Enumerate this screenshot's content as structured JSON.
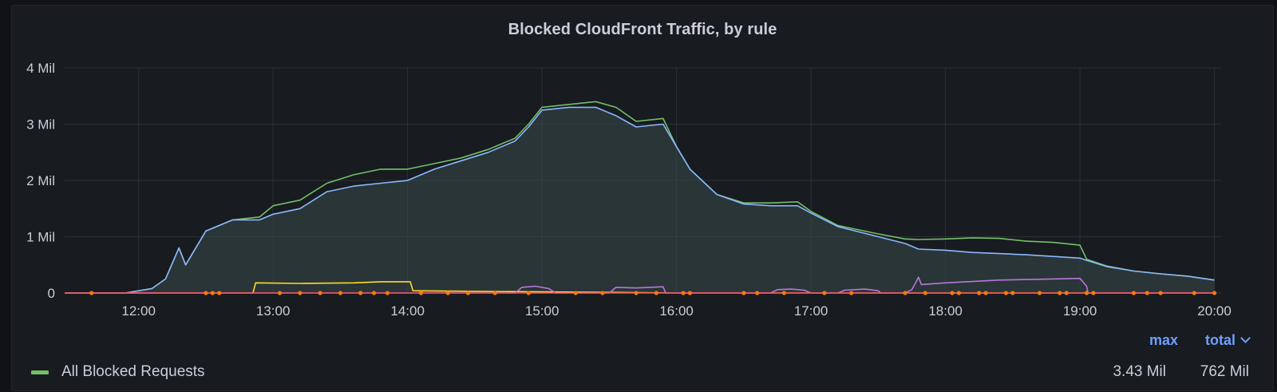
{
  "panel": {
    "title": "Blocked CloudFront Traffic, by rule"
  },
  "legend": {
    "columns": {
      "max": "max",
      "total": "total"
    },
    "items": [
      {
        "name": "All Blocked Requests",
        "color": "#73bf69",
        "max": "3.43 Mil",
        "total": "762 Mil"
      }
    ]
  },
  "chart_data": {
    "type": "area",
    "title": "Blocked CloudFront Traffic, by rule",
    "xlabel": "",
    "ylabel": "",
    "y_ticks": [
      "0",
      "1 Mil",
      "2 Mil",
      "3 Mil",
      "4 Mil"
    ],
    "ylim": [
      0,
      4000000
    ],
    "x_ticks": [
      "12:00",
      "13:00",
      "14:00",
      "15:00",
      "16:00",
      "17:00",
      "18:00",
      "19:00",
      "20:00"
    ],
    "xlim": [
      11.45,
      20.05
    ],
    "grid": true,
    "legend_position": "bottom",
    "series": [
      {
        "name": "All Blocked Requests",
        "color": "#73bf69",
        "x": [
          11.45,
          11.9,
          12.1,
          12.2,
          12.3,
          12.35,
          12.5,
          12.7,
          12.9,
          13.0,
          13.2,
          13.4,
          13.6,
          13.8,
          14.0,
          14.2,
          14.4,
          14.6,
          14.8,
          14.9,
          15.0,
          15.2,
          15.4,
          15.55,
          15.7,
          15.9,
          16.0,
          16.1,
          16.3,
          16.5,
          16.7,
          16.9,
          17.0,
          17.2,
          17.5,
          17.7,
          17.8,
          18.0,
          18.2,
          18.4,
          18.6,
          18.8,
          19.0,
          19.05,
          19.2,
          19.4,
          19.6,
          19.8,
          20.0
        ],
        "y": [
          0,
          0,
          80000,
          250000,
          800000,
          500000,
          1100000,
          1300000,
          1350000,
          1550000,
          1650000,
          1950000,
          2100000,
          2200000,
          2200000,
          2300000,
          2400000,
          2550000,
          2750000,
          3000000,
          3300000,
          3350000,
          3400000,
          3300000,
          3050000,
          3100000,
          2600000,
          2200000,
          1750000,
          1600000,
          1600000,
          1620000,
          1450000,
          1200000,
          1050000,
          960000,
          950000,
          960000,
          980000,
          970000,
          920000,
          900000,
          850000,
          600000,
          480000,
          390000,
          340000,
          300000,
          230000
        ]
      },
      {
        "name": "",
        "color": "#8ab8ff",
        "x": [
          11.45,
          11.9,
          12.1,
          12.2,
          12.3,
          12.35,
          12.5,
          12.7,
          12.9,
          13.0,
          13.2,
          13.4,
          13.6,
          13.8,
          14.0,
          14.2,
          14.4,
          14.6,
          14.8,
          14.9,
          15.0,
          15.2,
          15.4,
          15.55,
          15.7,
          15.9,
          16.0,
          16.1,
          16.3,
          16.5,
          16.7,
          16.9,
          17.0,
          17.2,
          17.5,
          17.7,
          17.8,
          18.0,
          18.2,
          18.4,
          18.6,
          18.8,
          19.0,
          19.05,
          19.2,
          19.4,
          19.6,
          19.8,
          20.0
        ],
        "y": [
          0,
          0,
          80000,
          250000,
          800000,
          500000,
          1100000,
          1300000,
          1300000,
          1400000,
          1500000,
          1800000,
          1900000,
          1950000,
          2000000,
          2200000,
          2350000,
          2500000,
          2700000,
          2950000,
          3250000,
          3300000,
          3300000,
          3150000,
          2950000,
          3000000,
          2600000,
          2200000,
          1750000,
          1580000,
          1550000,
          1550000,
          1420000,
          1180000,
          1000000,
          880000,
          780000,
          760000,
          720000,
          700000,
          680000,
          650000,
          620000,
          580000,
          470000,
          390000,
          340000,
          300000,
          230000
        ]
      },
      {
        "name": "",
        "color": "#fade2a",
        "x": [
          11.45,
          12.85,
          12.87,
          13.2,
          13.6,
          13.8,
          14.02,
          14.04,
          14.5,
          15.0,
          15.6,
          16.0,
          20.0
        ],
        "y": [
          0,
          0,
          180000,
          170000,
          180000,
          200000,
          200000,
          40000,
          30000,
          20000,
          10000,
          0,
          0
        ]
      },
      {
        "name": "",
        "color": "#b877d9",
        "x": [
          11.45,
          14.8,
          14.85,
          14.95,
          15.05,
          15.1,
          15.5,
          15.55,
          15.7,
          15.9,
          15.92,
          16.7,
          16.75,
          16.85,
          16.95,
          17.0,
          17.2,
          17.25,
          17.4,
          17.5,
          17.52,
          17.7,
          17.75,
          17.8,
          17.82,
          18.0,
          18.4,
          18.8,
          19.0,
          19.05,
          19.06,
          20.0
        ],
        "y": [
          0,
          0,
          100000,
          120000,
          80000,
          0,
          0,
          100000,
          90000,
          110000,
          0,
          0,
          60000,
          70000,
          50000,
          0,
          0,
          50000,
          70000,
          40000,
          0,
          0,
          60000,
          280000,
          150000,
          180000,
          230000,
          250000,
          260000,
          120000,
          0,
          0
        ]
      },
      {
        "name": "",
        "color": "#f2495c",
        "x": [
          11.45,
          20.0
        ],
        "y": [
          0,
          0
        ]
      }
    ]
  }
}
